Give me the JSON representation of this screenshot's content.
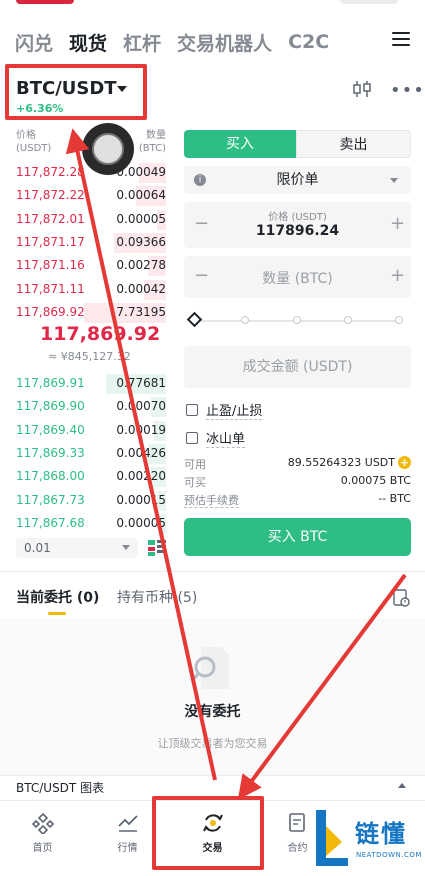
{
  "top_tabs": [
    "闪兑",
    "现货",
    "杠杆",
    "交易机器人",
    "C2C"
  ],
  "active_tab": "现货",
  "pair": {
    "symbol": "BTC/USDT",
    "change": "+6.36%"
  },
  "orderbook": {
    "price_header": [
      "价格",
      "(USDT)"
    ],
    "qty_header": [
      "数量",
      "(BTC)"
    ],
    "asks": [
      {
        "price": "117,872.28",
        "qty": "0.00049",
        "depth": 0.18
      },
      {
        "price": "117,872.22",
        "qty": "0.00064",
        "depth": 0.2
      },
      {
        "price": "117,872.01",
        "qty": "0.00005",
        "depth": 0.06
      },
      {
        "price": "117,871.17",
        "qty": "0.09366",
        "depth": 0.35
      },
      {
        "price": "117,871.16",
        "qty": "0.00278",
        "depth": 0.12
      },
      {
        "price": "117,871.11",
        "qty": "0.00042",
        "depth": 0.15
      },
      {
        "price": "117,869.92",
        "qty": "7.73195",
        "depth": 0.55
      }
    ],
    "mid_price": "117,869.92",
    "mid_sub": "≈ ¥845,127.32",
    "bids": [
      {
        "price": "117,869.91",
        "qty": "0.77681",
        "depth": 0.4
      },
      {
        "price": "117,869.90",
        "qty": "0.00070",
        "depth": 0.1
      },
      {
        "price": "117,869.40",
        "qty": "0.00019",
        "depth": 0.08
      },
      {
        "price": "117,869.33",
        "qty": "0.00426",
        "depth": 0.12
      },
      {
        "price": "117,868.00",
        "qty": "0.00220",
        "depth": 0.1
      },
      {
        "price": "117,867.73",
        "qty": "0.00015",
        "depth": 0.06
      },
      {
        "price": "117,867.68",
        "qty": "0.00005",
        "depth": 0.05
      }
    ],
    "step": "0.01"
  },
  "order_form": {
    "buy_tab": "买入",
    "sell_tab": "卖出",
    "order_type": "限价单",
    "price_label": "价格 (USDT)",
    "price_value": "117896.24",
    "qty_placeholder": "数量 (BTC)",
    "amount_placeholder": "成交金额 (USDT)",
    "tp_sl": "止盈/止损",
    "iceberg": "冰山单",
    "available_label": "可用",
    "available_value": "89.55264323 USDT",
    "can_buy_label": "可买",
    "can_buy_value": "0.00075 BTC",
    "fee_label": "预估手续费",
    "fee_value": "-- BTC",
    "buy_button": "买入 BTC"
  },
  "orders": {
    "tab_current": "当前委托 (0)",
    "tab_holdings": "持有币种 (5)",
    "empty_title": "没有委托",
    "empty_sub": "让顶级交易者为您交易"
  },
  "chart_bar": {
    "label": "BTC/USDT 图表"
  },
  "bottom_nav": [
    {
      "label": "首页",
      "icon": "home-icon"
    },
    {
      "label": "行情",
      "icon": "market-icon"
    },
    {
      "label": "交易",
      "icon": "trade-icon"
    },
    {
      "label": "合约",
      "icon": "futures-icon"
    }
  ],
  "brand": {
    "text": "链懂",
    "sub": "NEATDOWN.COM"
  },
  "colors": {
    "buy": "#2ebd85",
    "sell": "#e0294a",
    "accent": "#f0b90b",
    "annotation": "#e53935"
  }
}
